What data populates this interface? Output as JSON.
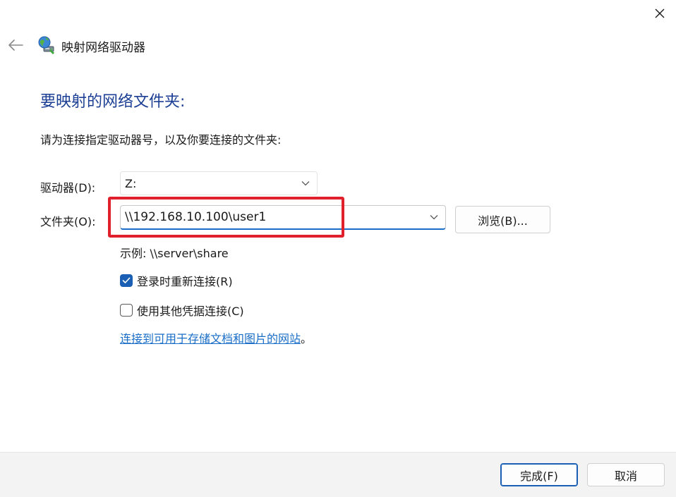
{
  "window": {
    "title": "映射网络驱动器",
    "icons": {
      "back": "back-arrow-icon",
      "close": "close-icon",
      "app": "network-drive-icon"
    }
  },
  "content": {
    "heading": "要映射的网络文件夹:",
    "instruction": "请为连接指定驱动器号，以及你要连接的文件夹:"
  },
  "drive": {
    "label": "驱动器(D):",
    "value": "Z:"
  },
  "folder": {
    "label": "文件夹(O):",
    "value": "\\\\192.168.10.100\\user1",
    "browse_label": "浏览(B)...",
    "example": "示例: \\\\server\\share"
  },
  "options": {
    "reconnect_label": "登录时重新连接(R)",
    "reconnect_checked": true,
    "other_creds_label": "使用其他凭据连接(C)",
    "other_creds_checked": false
  },
  "link": {
    "text": "连接到可用于存储文档和图片的网站",
    "suffix": "。"
  },
  "footer": {
    "finish_label": "完成(F)",
    "cancel_label": "取消"
  },
  "colors": {
    "heading": "#1c3f94",
    "accent": "#1a5fb4",
    "link": "#1a6ec7",
    "highlight": "#e0202b",
    "footer_bg": "#f3f3f3"
  }
}
